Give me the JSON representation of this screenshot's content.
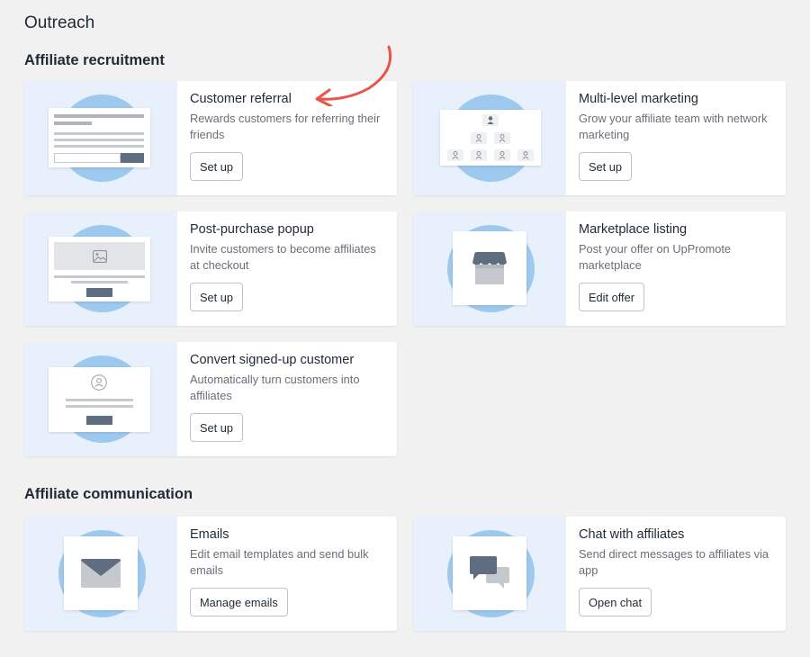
{
  "page": {
    "title": "Outreach"
  },
  "sections": {
    "recruitment": "Affiliate recruitment",
    "communication": "Affiliate communication"
  },
  "cards": {
    "customer_referral": {
      "title": "Customer referral",
      "desc": "Rewards customers for referring their friends",
      "button": "Set up"
    },
    "multi_level": {
      "title": "Multi-level marketing",
      "desc": "Grow your affiliate team with network marketing",
      "button": "Set up"
    },
    "post_purchase": {
      "title": "Post-purchase popup",
      "desc": "Invite customers to become affiliates at checkout",
      "button": "Set up"
    },
    "marketplace": {
      "title": "Marketplace listing",
      "desc": "Post your offer on UpPromote marketplace",
      "button": "Edit offer"
    },
    "convert_signed_up": {
      "title": "Convert signed-up customer",
      "desc": "Automatically turn customers into affiliates",
      "button": "Set up"
    },
    "emails": {
      "title": "Emails",
      "desc": "Edit email templates and send bulk emails",
      "button": "Manage emails"
    },
    "chat": {
      "title": "Chat with affiliates",
      "desc": "Send direct messages to affiliates via app",
      "button": "Open chat"
    }
  },
  "colors": {
    "background": "#f1f1f1",
    "illustration_bg": "#e8f1fb",
    "circle": "#9ec9ef",
    "slate": "#5e6e80",
    "annotation_arrow": "#e8564a"
  },
  "icons": [
    "image-icon",
    "user-icon",
    "store-icon",
    "mail-icon",
    "chat-icon",
    "annotation-arrow-icon"
  ]
}
